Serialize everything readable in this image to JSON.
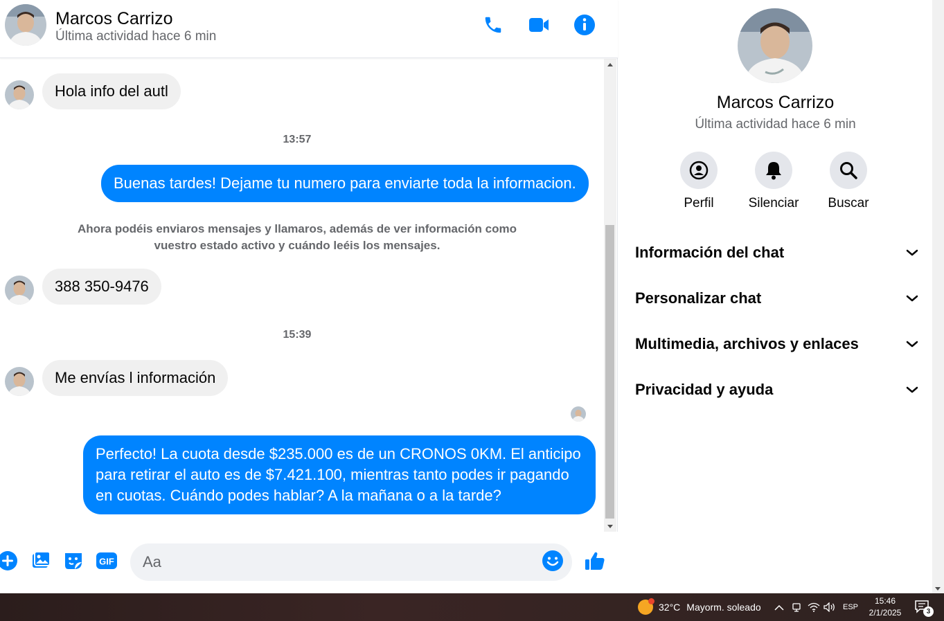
{
  "contact": {
    "name": "Marcos Carrizo",
    "status": "Última actividad hace 6 min"
  },
  "colors": {
    "accent": "#0084ff",
    "incoming_bubble": "#f0f0f0",
    "secondary_text": "#65676b"
  },
  "header": {
    "icons": [
      "phone-icon",
      "video-icon",
      "info-icon"
    ]
  },
  "messages": {
    "m1": "Hola info del autl",
    "t1": "13:57",
    "m2": "Buenas tardes! Dejame tu numero para enviarte toda la informacion.",
    "system_line1": "Ahora podéis enviaros mensajes y llamaros, además de ver información como",
    "system_line2": "vuestro estado activo y cuándo leéis los mensajes.",
    "m3": "388 350-9476",
    "t2": "15:39",
    "m4": "Me envías l información",
    "m5_line1": "Perfecto! La cuota desde $235.000 es de un CRONOS 0KM. El anticipo",
    "m5_line2": "para retirar el auto es de $7.421.100, mientras tanto podes ir pagando",
    "m5_line3": "en cuotas. Cuándo podes hablar? A la mañana o a la tarde?"
  },
  "composer": {
    "placeholder": "Aa",
    "icons": [
      "plus-icon",
      "image-icon",
      "sticker-icon",
      "gif-icon",
      "emoji-icon",
      "like-icon"
    ],
    "gif_label": "GIF"
  },
  "panel": {
    "actions": [
      {
        "label": "Perfil",
        "icon": "profile-icon"
      },
      {
        "label": "Silenciar",
        "icon": "bell-icon"
      },
      {
        "label": "Buscar",
        "icon": "search-icon"
      }
    ],
    "sections": [
      {
        "label": "Información del chat"
      },
      {
        "label": "Personalizar chat"
      },
      {
        "label": "Multimedia, archivos y enlaces"
      },
      {
        "label": "Privacidad y ayuda"
      }
    ]
  },
  "taskbar": {
    "temperature": "32°C",
    "weather": "Mayorm. soleado",
    "language": "ESP",
    "time": "15:46",
    "date": "2/1/2025",
    "notification_count": "3"
  }
}
